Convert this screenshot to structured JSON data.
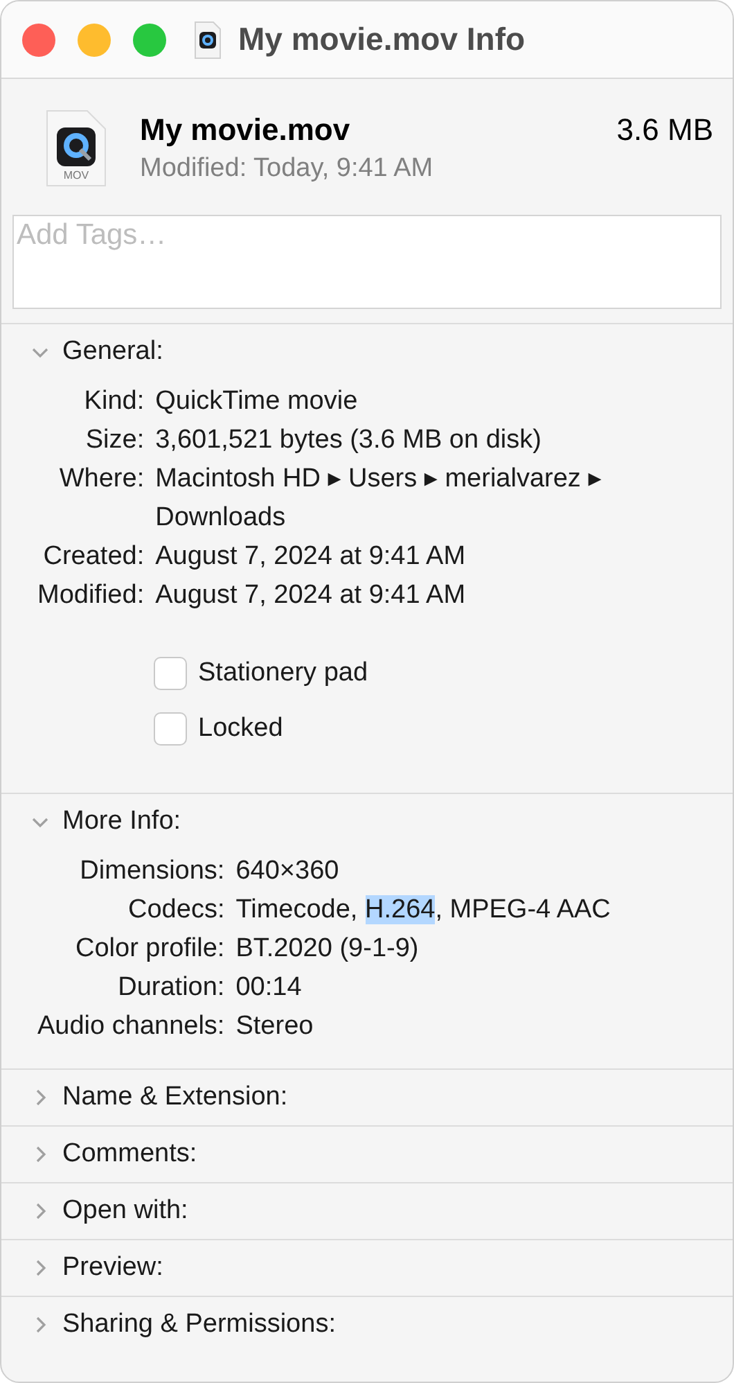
{
  "window": {
    "title": "My movie.mov Info"
  },
  "file": {
    "name": "My movie.mov",
    "size": "3.6 MB",
    "modified": "Modified: Today, 9:41 AM",
    "icon_label": "MOV"
  },
  "tags": {
    "placeholder": "Add Tags…"
  },
  "sections": [
    {
      "title": "General:",
      "expanded": true,
      "rows": [
        {
          "label": "Kind:",
          "segments": [
            {
              "text": "QuickTime movie",
              "selected": false
            }
          ]
        },
        {
          "label": "Size:",
          "segments": [
            {
              "text": "3,601,521 bytes (3.6 MB on disk)",
              "selected": false
            }
          ]
        },
        {
          "label": "Where:",
          "segments": [
            {
              "text": "Macintosh HD ▸ Users ▸ merialvarez ▸ Downloads",
              "selected": false
            }
          ]
        },
        {
          "label": "Created:",
          "segments": [
            {
              "text": "August 7, 2024 at 9:41 AM",
              "selected": false
            }
          ]
        },
        {
          "label": "Modified:",
          "segments": [
            {
              "text": "August 7, 2024 at 9:41 AM",
              "selected": false
            }
          ]
        }
      ],
      "checkboxes": [
        {
          "label": "Stationery pad",
          "checked": false
        },
        {
          "label": "Locked",
          "checked": false
        }
      ]
    },
    {
      "title": "More Info:",
      "expanded": true,
      "rows": [
        {
          "label": "Dimensions:",
          "segments": [
            {
              "text": "640×360",
              "selected": false
            }
          ]
        },
        {
          "label": "Codecs:",
          "segments": [
            {
              "text": "Timecode, ",
              "selected": false
            },
            {
              "text": "H.264",
              "selected": true
            },
            {
              "text": ", MPEG-4 AAC",
              "selected": false
            }
          ]
        },
        {
          "label": "Color profile:",
          "segments": [
            {
              "text": "BT.2020 (9-1-9)",
              "selected": false
            }
          ]
        },
        {
          "label": "Duration:",
          "segments": [
            {
              "text": "00:14",
              "selected": false
            }
          ]
        },
        {
          "label": "Audio channels:",
          "segments": [
            {
              "text": "Stereo",
              "selected": false
            }
          ]
        }
      ]
    },
    {
      "title": "Name & Extension:",
      "expanded": false
    },
    {
      "title": "Comments:",
      "expanded": false
    },
    {
      "title": "Open with:",
      "expanded": false
    },
    {
      "title": "Preview:",
      "expanded": false
    },
    {
      "title": "Sharing & Permissions:",
      "expanded": false
    }
  ]
}
